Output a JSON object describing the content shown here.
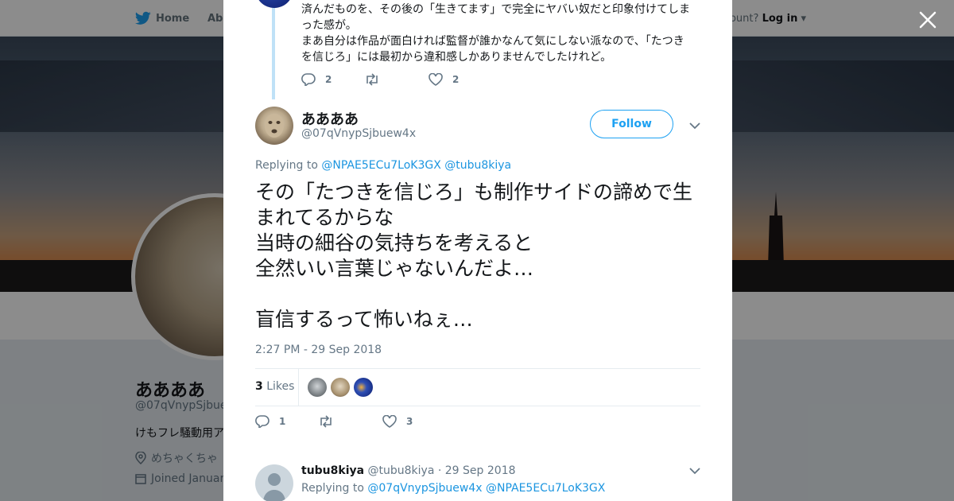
{
  "nav": {
    "home_label": "Home",
    "about_label": "Abo",
    "account_prompt": "ccount?",
    "login_label": "Log in"
  },
  "profile": {
    "name": "ああああ",
    "handle": "@07qVnypSjbuew",
    "bio": "けもフレ騒動用ア",
    "location": "めちゃくちゃ",
    "joined": "Joined Januar"
  },
  "previous_tweet": {
    "text_line1": "済んだものを、その後の「生きてます」で完全にヤバい奴だと印象付けてしま",
    "text_line2": "った感が。",
    "text_line3": "まあ自分は作品が面白ければ監督が誰かなんて気にしない派なので、「たつき",
    "text_line4": "を信じろ」には最初から違和感しかありませんでしたけれど。",
    "reply_count": "2",
    "retweet_count": "",
    "like_count": "2"
  },
  "tweet": {
    "author_name": "ああああ",
    "author_handle": "@07qVnypSjbuew4x",
    "follow_label": "Follow",
    "replying_prefix": "Replying to",
    "replying_user1": "@NPAE5ECu7LoK3GX",
    "replying_user2": "@tubu8kiya",
    "text": "その「たつきを信じろ」も制作サイドの諦めで生まれてるからな\n当時の細谷の気持ちを考えると\n全然いい言葉じゃないんだよ…\n\n盲信するって怖いねぇ…",
    "timestamp": "2:27 PM - 29 Sep 2018",
    "likes_number": "3",
    "likes_label": "Likes",
    "reply_count": "1",
    "retweet_count": "",
    "like_count": "3"
  },
  "reply": {
    "name": "tubu8kiya",
    "handle": "@tubu8kiya",
    "date": "· 29 Sep 2018",
    "replying_prefix": "Replying to",
    "replying_user1": "@07qVnypSjbuew4x",
    "replying_user2": "@NPAE5ECu7LoK3GX"
  },
  "colors": {
    "accent": "#1da1f2",
    "link": "#1b95e0",
    "muted": "#657786",
    "text": "#14171a"
  },
  "icons": [
    "twitter-bird-icon",
    "close-icon",
    "reply-icon",
    "retweet-icon",
    "heart-icon",
    "chevron-down-icon",
    "location-icon",
    "calendar-icon"
  ]
}
